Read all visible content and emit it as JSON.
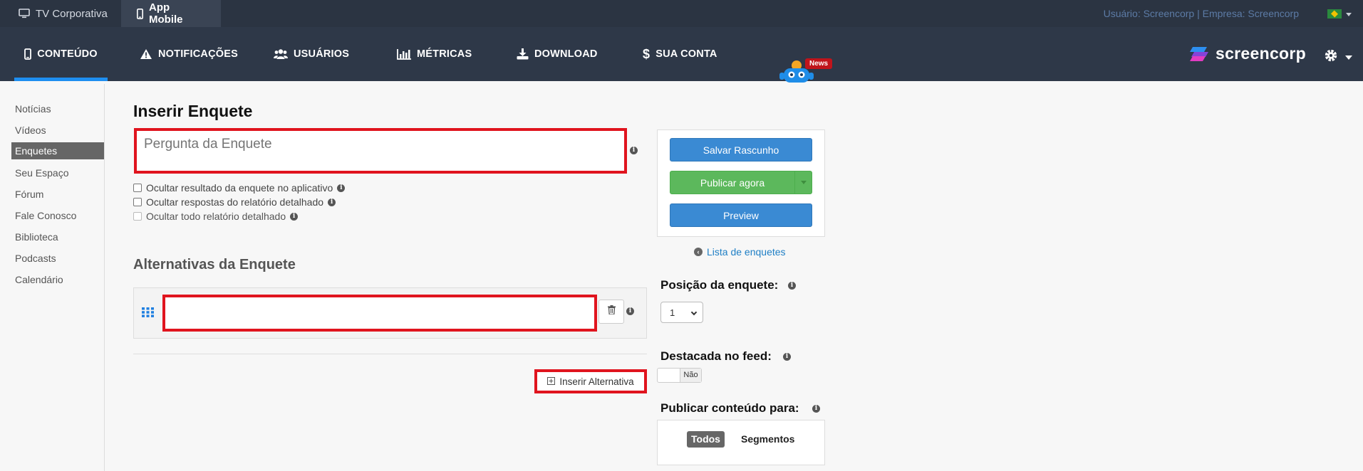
{
  "topbar": {
    "tabs": [
      {
        "label": "TV Corporativa",
        "icon": "monitor-icon",
        "active": false
      },
      {
        "label": "App Mobile",
        "icon": "mobile-icon",
        "active": true
      }
    ],
    "user_info": "Usuário: Screencorp | Empresa: Screencorp",
    "language_flag": "brazil-flag-icon"
  },
  "nav": {
    "items": [
      {
        "label": "CONTEÚDO",
        "icon": "mobile-icon",
        "active": true
      },
      {
        "label": "NOTIFICAÇÕES",
        "icon": "warning-icon",
        "active": false
      },
      {
        "label": "USUÁRIOS",
        "icon": "users-icon",
        "active": false
      },
      {
        "label": "MÉTRICAS",
        "icon": "bar-chart-icon",
        "active": false
      },
      {
        "label": "DOWNLOAD",
        "icon": "download-icon",
        "active": false
      },
      {
        "label": "SUA CONTA",
        "icon": "dollar-icon",
        "active": false
      }
    ],
    "news_badge": "News",
    "logo_text": "screencorp"
  },
  "sidebar": {
    "items": [
      {
        "label": "Notícias"
      },
      {
        "label": "Vídeos"
      },
      {
        "label": "Enquetes",
        "active": true
      },
      {
        "label": "Seu Espaço"
      },
      {
        "label": "Fórum"
      },
      {
        "label": "Fale Conosco"
      },
      {
        "label": "Biblioteca"
      },
      {
        "label": "Podcasts"
      },
      {
        "label": "Calendário"
      }
    ]
  },
  "form": {
    "title": "Inserir Enquete",
    "question_placeholder": "Pergunta da Enquete",
    "options": [
      {
        "label": "Ocultar resultado da enquete no aplicativo",
        "checked": false,
        "disabled": false
      },
      {
        "label": "Ocultar respostas do relatório detalhado",
        "checked": false,
        "disabled": false
      },
      {
        "label": "Ocultar todo relatório detalhado",
        "checked": false,
        "disabled": true
      }
    ],
    "alternatives_title": "Alternativas da Enquete",
    "alternative_value": "",
    "insert_alternative_label": "Inserir Alternativa"
  },
  "side_panel": {
    "save_draft_label": "Salvar Rascunho",
    "publish_label": "Publicar agora",
    "preview_label": "Preview",
    "list_link_label": "Lista de enquetes",
    "position_label": "Posição da enquete:",
    "position_value": "1",
    "featured_label": "Destacada no feed:",
    "featured_value": "Não",
    "publish_to_label": "Publicar conteúdo para:",
    "segments": [
      {
        "label": "Todos",
        "active": true
      },
      {
        "label": "Segmentos",
        "active": false
      }
    ]
  },
  "colors": {
    "primary_blue": "#3a8ad3",
    "success_green": "#5cb85c",
    "highlight_red": "#e0141e",
    "nav_bg": "#2e3848"
  }
}
